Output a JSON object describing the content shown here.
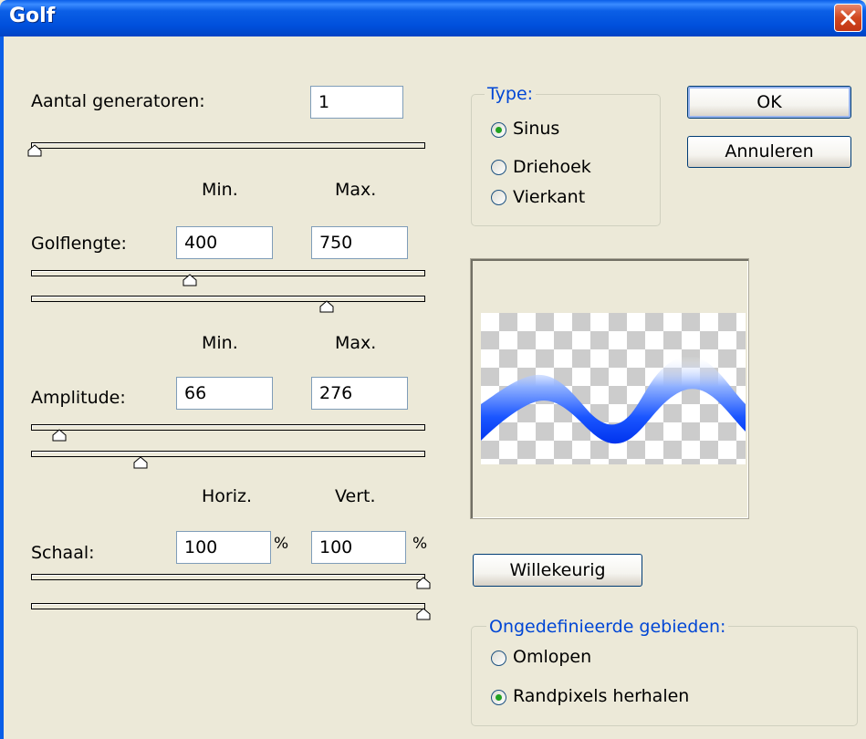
{
  "window": {
    "title": "Golf"
  },
  "generators": {
    "label": "Aantal generatoren:",
    "value": "1"
  },
  "wavelength": {
    "header_min": "Min.",
    "header_max": "Max.",
    "label": "Golflengte:",
    "min_value": "400",
    "max_value": "750"
  },
  "amplitude": {
    "header_min": "Min.",
    "header_max": "Max.",
    "label": "Amplitude:",
    "min_value": "66",
    "max_value": "276"
  },
  "scale": {
    "header_horiz": "Horiz.",
    "header_vert": "Vert.",
    "label": "Schaal:",
    "horiz_value": "100",
    "vert_value": "100",
    "percent_horiz": "%",
    "percent_vert": "%"
  },
  "type_group": {
    "legend": "Type:",
    "options": [
      {
        "label": "Sinus",
        "selected": true
      },
      {
        "label": "Driehoek",
        "selected": false
      },
      {
        "label": "Vierkant",
        "selected": false
      }
    ]
  },
  "buttons": {
    "ok": "OK",
    "cancel": "Annuleren",
    "randomize": "Willekeurig"
  },
  "undefined_group": {
    "legend": "Ongedefinieerde gebieden:",
    "options": [
      {
        "label": "Omlopen",
        "selected": false
      },
      {
        "label": "Randpixels herhalen",
        "selected": true
      }
    ]
  },
  "colors": {
    "titlebar": "#0054e3",
    "wave": "#0044ff",
    "accent_legend": "#0046d5"
  },
  "icons": {
    "close": "close-icon",
    "slider_thumb": "slider-thumb-icon"
  }
}
